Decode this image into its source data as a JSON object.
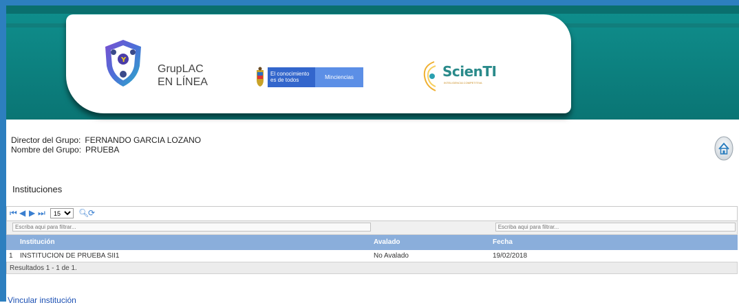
{
  "banner": {
    "app_name_line1": "GrupLAC",
    "app_name_line2": "EN LÍNEA",
    "gov_text_line1": "El conocimiento",
    "gov_text_line2": "es de todos",
    "gov_ministry": "Minciencias",
    "scienti_name": "ScienTI",
    "scienti_sub": "INTELIGENCIA COMPETITIVA",
    "colors": {
      "teal": "#0f8f8d",
      "frame": "#2d7fbf",
      "gov_blue": "#3366cc"
    }
  },
  "group": {
    "director_label": "Director del Grupo:",
    "director_value": "FERNANDO GARCIA LOZANO",
    "name_label": "Nombre del Grupo:",
    "name_value": "PRUEBA"
  },
  "section_title": "Instituciones",
  "grid": {
    "page_size": "15",
    "filter_placeholder": "Escriba aqui para filtrar...",
    "columns": [
      "",
      "Institución",
      "Avalado",
      "Fecha"
    ],
    "rows": [
      {
        "num": "1",
        "institucion": "INSTITUCION DE PRUEBA SII1",
        "avalado": "No Avalado",
        "fecha": "19/02/2018"
      }
    ],
    "results": "Resultados 1 - 1 de 1.",
    "header_color": "#8aaedb"
  },
  "link_label": "Vincular institución"
}
